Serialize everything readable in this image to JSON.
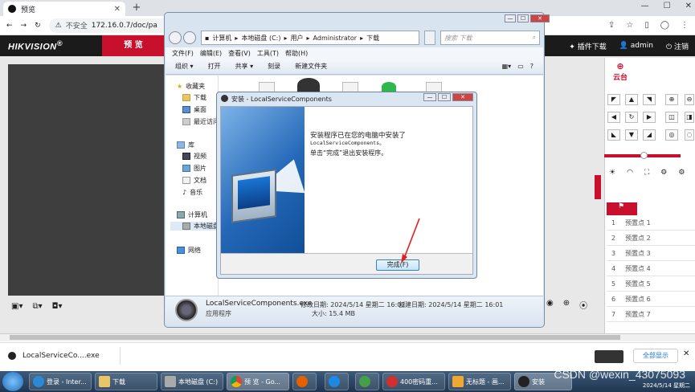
{
  "browser": {
    "tab_title": "预览",
    "not_secure": "不安全",
    "url": "172.16.0.7/doc/pa"
  },
  "hik": {
    "logo": "HIKVISION",
    "registered": "®",
    "nav_preview": "预 览",
    "plugin_download": "插件下载",
    "user": "admin",
    "logout": "注销",
    "ptz_label": "云台",
    "presets": [
      "预置点 1",
      "预置点 2",
      "预置点 3",
      "预置点 4",
      "预置点 5",
      "预置点 6",
      "预置点 7"
    ],
    "preset_numbers": [
      "1",
      "2",
      "3",
      "4",
      "5",
      "6",
      "7"
    ]
  },
  "explorer": {
    "path": [
      "计算机",
      "本地磁盘 (C:)",
      "用户",
      "Administrator",
      "下载"
    ],
    "search_placeholder": "搜索 下载",
    "menu": [
      "文件(F)",
      "编辑(E)",
      "查看(V)",
      "工具(T)",
      "帮助(H)"
    ],
    "commands": [
      "组织 ▾",
      "打开",
      "共享 ▾",
      "刻录",
      "新建文件夹"
    ],
    "nav": {
      "favorites": "收藏夹",
      "downloads": "下载",
      "desktop": "桌面",
      "recent": "最近访问",
      "libraries": "库",
      "videos": "视频",
      "pictures": "图片",
      "documents": "文档",
      "music": "音乐",
      "computer": "计算机",
      "local_disk": "本地磁盘",
      "network": "网络"
    },
    "details": {
      "name": "LocalServiceComponents.exe",
      "type": "应用程序",
      "modified": "修改日期: 2024/5/14 星期二 16:02",
      "created": "创建日期: 2024/5/14 星期二 16:01",
      "size": "大小: 15.4 MB"
    }
  },
  "installer": {
    "title": "安装 - LocalServiceComponents",
    "line1": "安装程序已在您的电脑中安装了",
    "line2": "LocalServiceComponents。",
    "line3": "单击“完成”退出安装程序。",
    "finish_button": "完成(F)"
  },
  "downloads_bar": {
    "item": "LocalServiceCo....exe",
    "show_all": "全部显示"
  },
  "taskbar": {
    "items": [
      "登录 - Inter...",
      "下载",
      "本地磁盘 (C:)",
      "预 览 - Go...",
      "400密码重...",
      "无标题 - 画...",
      "安装"
    ],
    "watermark": "CSDN @wexin_43075093",
    "clock": "2024/5/14 星期二"
  }
}
